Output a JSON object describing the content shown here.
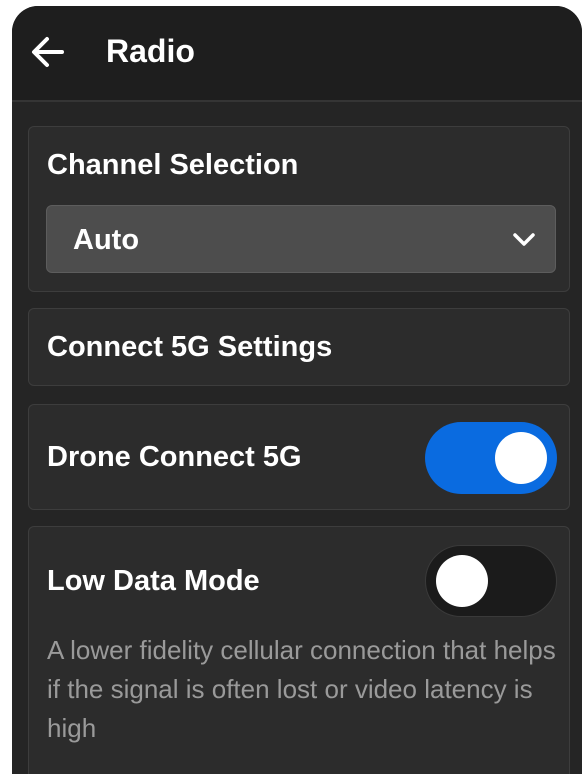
{
  "header": {
    "title": "Radio",
    "back_icon": "arrow-left-icon"
  },
  "channel_selection": {
    "label": "Channel Selection",
    "selected_value": "Auto",
    "dropdown_icon": "chevron-down-icon"
  },
  "connect_5g_settings": {
    "label": "Connect 5G Settings"
  },
  "drone_connect_5g": {
    "label": "Drone Connect 5G",
    "enabled": true
  },
  "low_data_mode": {
    "label": "Low Data Mode",
    "enabled": false,
    "description": "A lower fidelity cellular connection that helps if the signal is often lost or video latency is high"
  },
  "colors": {
    "background": "#252525",
    "header_background": "#1e1e1e",
    "card_background": "#2c2c2c",
    "select_background": "#4d4d4d",
    "toggle_on": "#0a6be0",
    "toggle_off": "#1b1b1b",
    "text_primary": "#ffffff",
    "text_secondary": "#9a9a9a"
  }
}
